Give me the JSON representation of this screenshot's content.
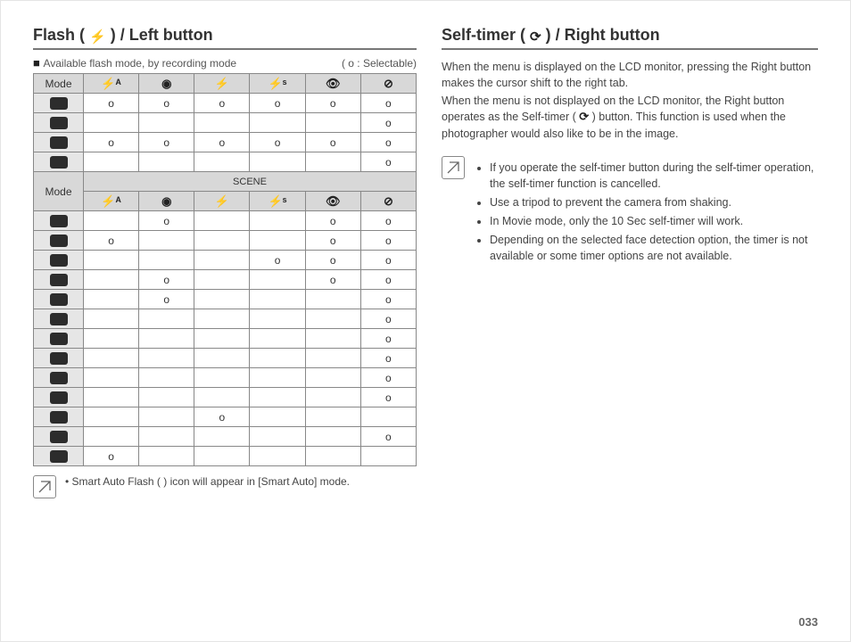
{
  "left": {
    "title_prefix": "Flash ( ",
    "title_suffix": " ) / Left button",
    "legend_left": "Available flash mode, by recording mode",
    "legend_right": "( o : Selectable)",
    "mode_label": "Mode",
    "scene_label": "SCENE",
    "col_icons": [
      "flash-auto-icon",
      "eye-icon",
      "flash-icon",
      "flash-slow-icon",
      "flash-redeye-icon",
      "flash-off-icon"
    ],
    "top_rows": [
      {
        "v": [
          "o",
          "o",
          "o",
          "o",
          "o",
          "o"
        ]
      },
      {
        "v": [
          "",
          "",
          "",
          "",
          "",
          "o"
        ]
      },
      {
        "v": [
          "o",
          "o",
          "o",
          "o",
          "o",
          "o"
        ]
      },
      {
        "v": [
          "",
          "",
          "",
          "",
          "",
          "o"
        ]
      }
    ],
    "scene_rows": [
      {
        "v": [
          "",
          "o",
          "",
          "",
          "o",
          "o"
        ]
      },
      {
        "v": [
          "o",
          "",
          "",
          "",
          "o",
          "o"
        ]
      },
      {
        "v": [
          "",
          "",
          "",
          "o",
          "o",
          "o"
        ]
      },
      {
        "v": [
          "",
          "o",
          "",
          "",
          "o",
          "o"
        ]
      },
      {
        "v": [
          "",
          "o",
          "",
          "",
          "",
          "o"
        ]
      },
      {
        "v": [
          "",
          "",
          "",
          "",
          "",
          "o"
        ]
      },
      {
        "v": [
          "",
          "",
          "",
          "",
          "",
          "o"
        ]
      },
      {
        "v": [
          "",
          "",
          "",
          "",
          "",
          "o"
        ]
      },
      {
        "v": [
          "",
          "",
          "",
          "",
          "",
          "o"
        ]
      },
      {
        "v": [
          "",
          "",
          "",
          "",
          "",
          "o"
        ]
      },
      {
        "v": [
          "",
          "",
          "o",
          "",
          "",
          ""
        ]
      },
      {
        "v": [
          "",
          "",
          "",
          "",
          "",
          "o"
        ]
      },
      {
        "v": [
          "o",
          "",
          "",
          "",
          "",
          ""
        ]
      }
    ],
    "note_text": "Smart Auto Flash (    ) icon will appear in [Smart Auto] mode.",
    "note_bullet": "•"
  },
  "right": {
    "title_prefix": "Self-timer ( ",
    "title_suffix": " ) / Right button",
    "body1": "When the menu is displayed on the LCD monitor, pressing the Right button makes the cursor shift to the right tab.",
    "body2_a": "When the menu is not displayed on the LCD monitor, the Right button operates as the Self-timer ( ",
    "body2_b": " ) button. This function is used when the photographer would also like to be in the image.",
    "bullets": [
      "If you operate the self-timer button during the self-timer operation, the self-timer function is cancelled.",
      "Use a tripod to prevent the camera from shaking.",
      "In Movie mode, only the 10 Sec self-timer will work.",
      "Depending on the selected face detection option, the timer is not available or some timer options are not available."
    ]
  },
  "page_number": "033"
}
